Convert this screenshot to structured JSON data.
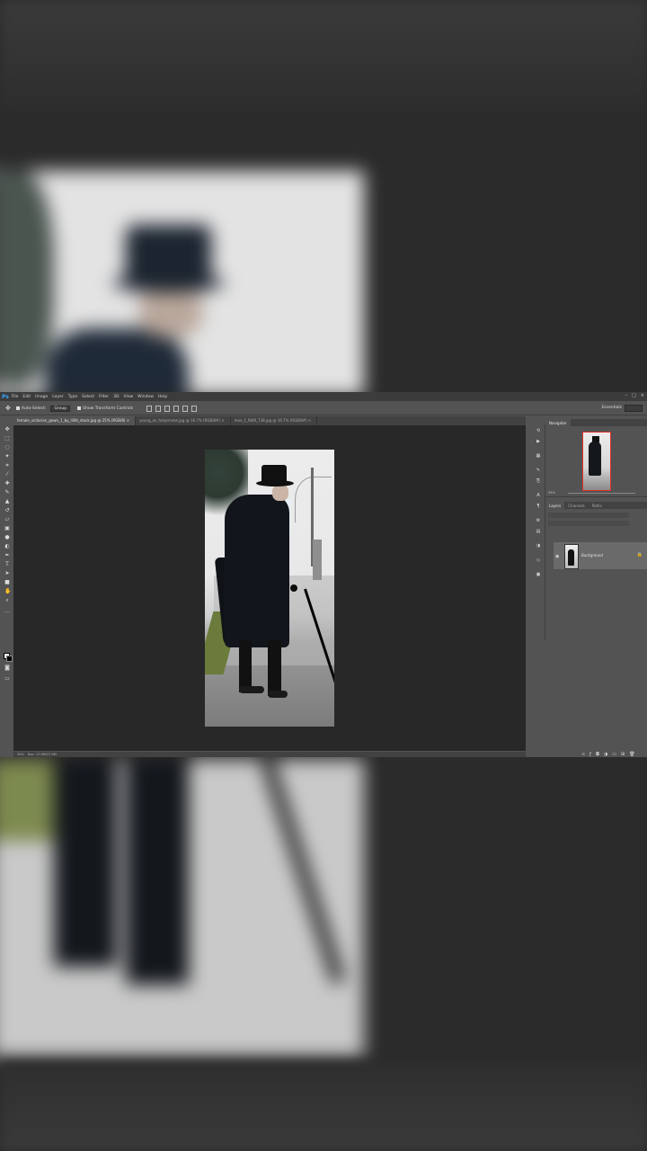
{
  "app": {
    "logo": "Ps",
    "menu": [
      "File",
      "Edit",
      "Image",
      "Layer",
      "Type",
      "Select",
      "Filter",
      "3D",
      "View",
      "Window",
      "Help"
    ],
    "window_controls": [
      "–",
      "□",
      "×"
    ]
  },
  "options_bar": {
    "auto_select_label": "Auto-Select:",
    "auto_select_value": "Group",
    "show_transform_label": "Show Transform Controls",
    "workspace": "Essentials"
  },
  "doc_tabs": [
    {
      "label": "female_victorian_gown_1_by_lilith_stock.jpg @ 25% (RGB/8) ×",
      "active": true
    },
    {
      "label": "young_an_holysmoke.jpg @ 16.7% (RGB/8#) ×",
      "active": false
    },
    {
      "label": "man_1_fb89_738.jpg @ 16.7% (RGB/8#) ×",
      "active": false
    }
  ],
  "status_bar": {
    "zoom": "25%",
    "doc_info": "Doc: 17.9M/17.9M"
  },
  "navigator": {
    "tab_label": "Navigator",
    "zoom": "25%"
  },
  "layers_panel": {
    "tabs": [
      "Layers",
      "Channels",
      "Paths"
    ],
    "layer_name": "Background"
  },
  "icons": [
    "move-icon",
    "marquee-icon",
    "lasso-icon",
    "magic-wand-icon",
    "crop-icon",
    "eyedropper-icon",
    "healing-icon",
    "brush-icon",
    "stamp-icon",
    "history-brush-icon",
    "eraser-icon",
    "gradient-icon",
    "blur-icon",
    "dodge-icon",
    "pen-icon",
    "type-icon",
    "path-select-icon",
    "shape-icon",
    "hand-icon",
    "zoom-icon",
    "eye-icon",
    "lock-icon"
  ]
}
